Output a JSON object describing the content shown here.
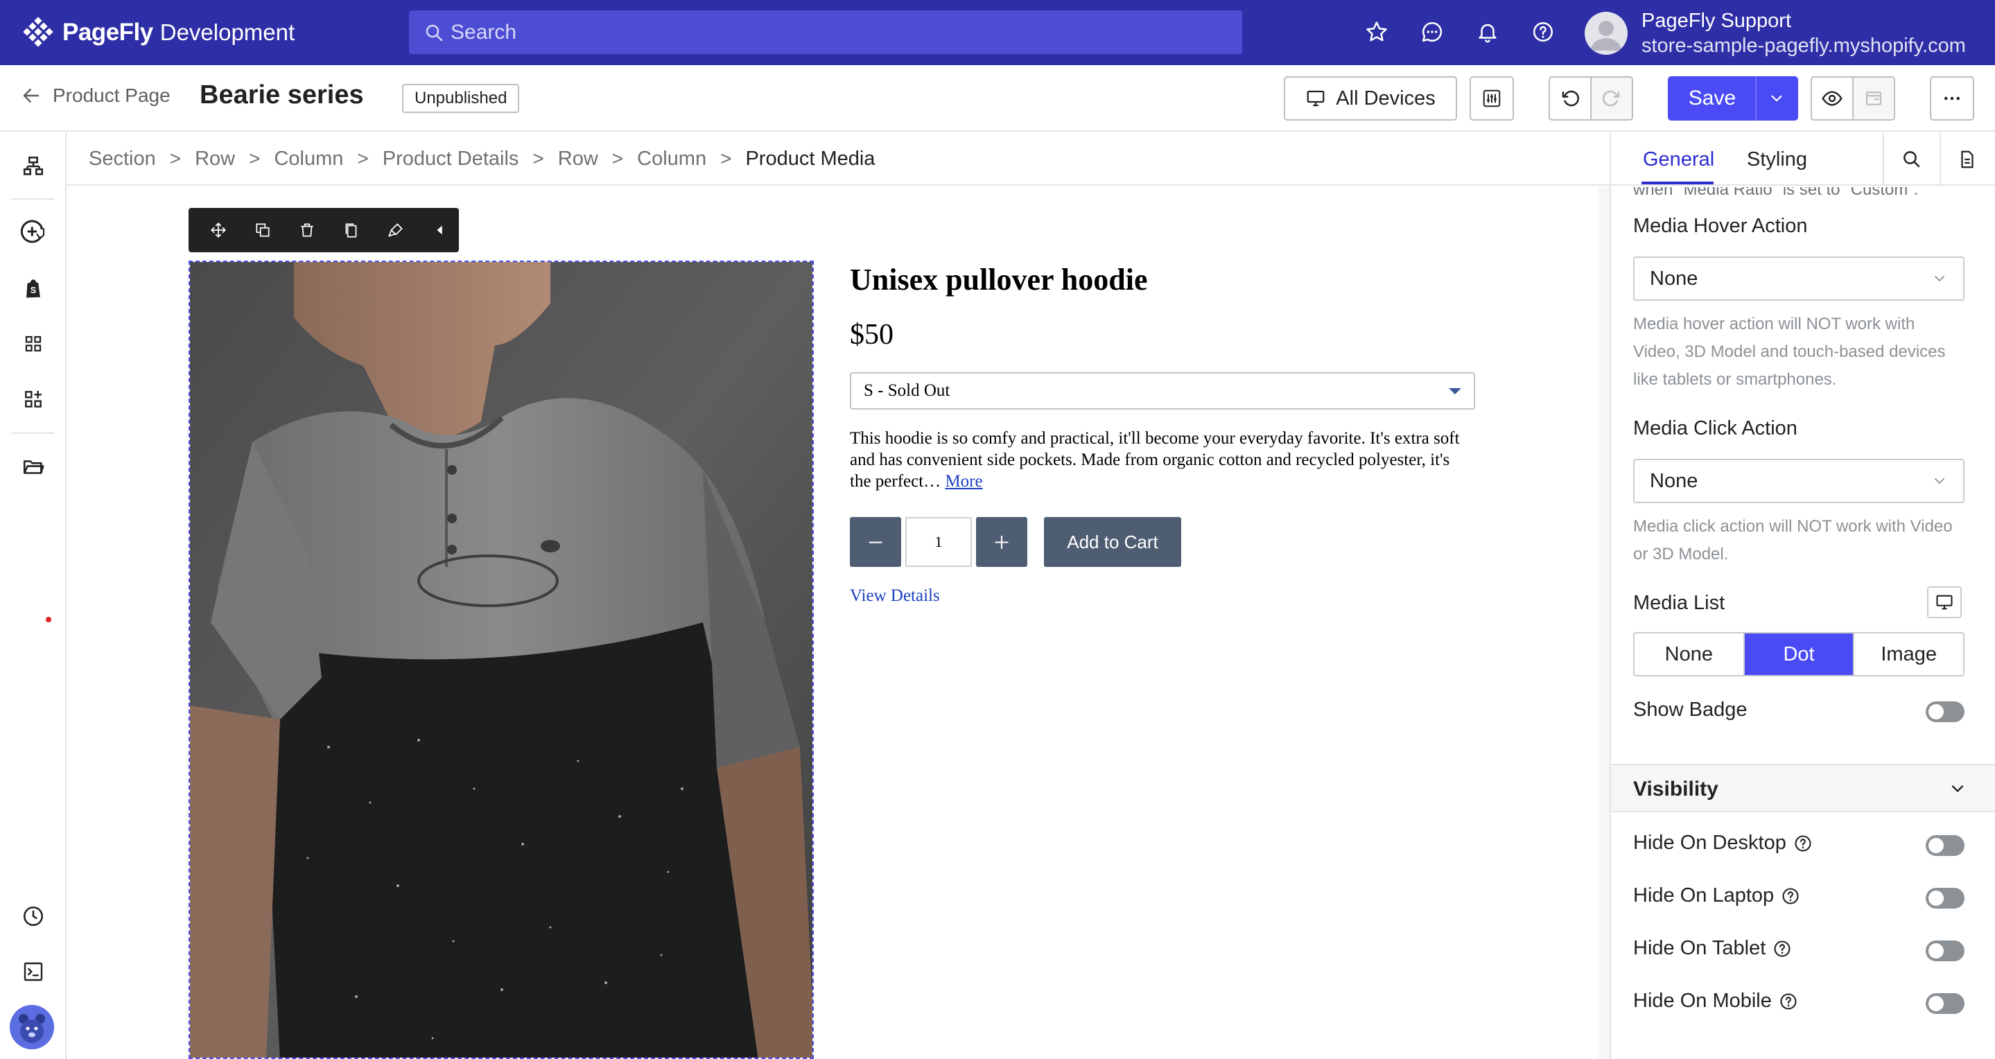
{
  "app": {
    "brand": "PageFly",
    "environment": "Development",
    "search_placeholder": "Search",
    "account_name": "PageFly Support",
    "account_store": "store-sample-pagefly.myshopify.com"
  },
  "header": {
    "back_label": "Product Page",
    "page_title": "Bearie series",
    "status": "Unpublished",
    "devices_label": "All Devices",
    "save_label": "Save"
  },
  "breadcrumb": [
    "Section",
    "Row",
    "Column",
    "Product Details",
    "Row",
    "Column",
    "Product Media"
  ],
  "product": {
    "title": "Unisex pullover hoodie",
    "price": "$50",
    "variant": "S - Sold Out",
    "description": "This hoodie is so comfy and practical, it'll become your everyday favorite. It's extra soft and has convenient side pockets. Made from organic cotton and recycled polyester, it's the perfect…",
    "more": "More",
    "qty_minus": "−",
    "qty": "1",
    "qty_plus": "+",
    "cart": "Add to Cart",
    "view_details": "View Details"
  },
  "panel": {
    "tabs": [
      "General",
      "Styling"
    ],
    "cut_note": "when \"Media Ratio\" is set to \"Custom\".",
    "hover_label": "Media Hover Action",
    "hover_value": "None",
    "hover_help": "Media hover action will NOT work with Video, 3D Model and touch-based devices like tablets or smartphones.",
    "click_label": "Media Click Action",
    "click_value": "None",
    "click_help": "Media click action will NOT work with Video or 3D Model.",
    "list_label": "Media List",
    "list_options": [
      "None",
      "Dot",
      "Image"
    ],
    "list_selected": "Dot",
    "badge_label": "Show Badge",
    "visibility_title": "Visibility",
    "visibility": [
      "Hide On Desktop",
      "Hide On Laptop",
      "Hide On Tablet",
      "Hide On Mobile"
    ]
  },
  "colors": {
    "topbar": "#2e2ea6",
    "accent": "#4b4bf5",
    "tab_active": "#2c2ccf"
  }
}
